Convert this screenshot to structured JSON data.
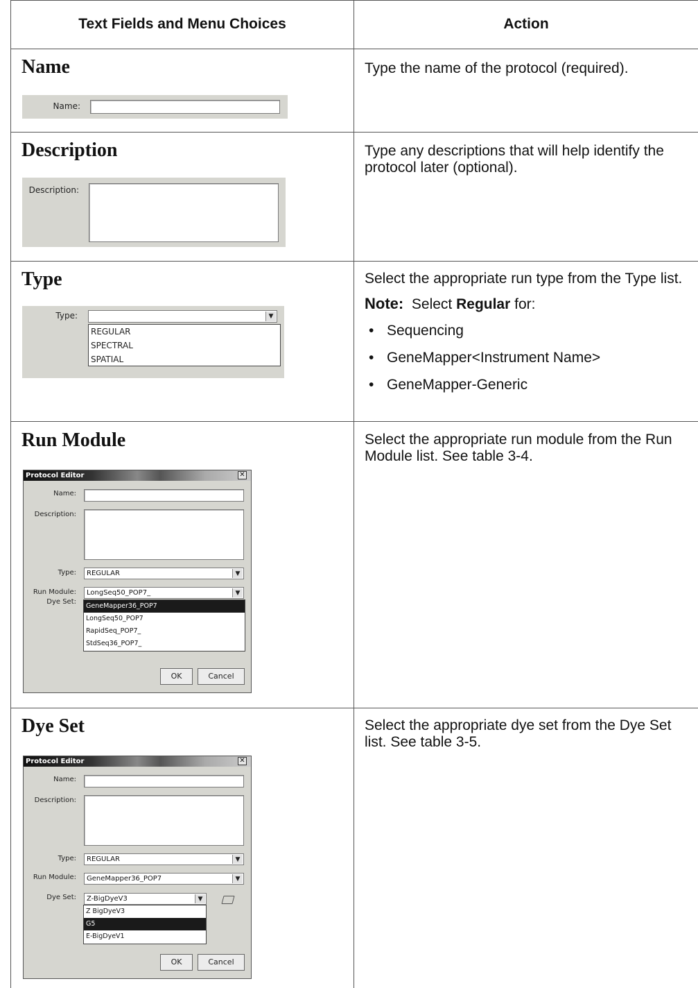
{
  "table": {
    "col1_header": "Text Fields and Menu Choices",
    "col2_header": "Action"
  },
  "rows": {
    "name": {
      "title": "Name",
      "action": "Type the name of the protocol (required).",
      "ui": {
        "name_label": "Name:",
        "name_value": ""
      }
    },
    "description": {
      "title": "Description",
      "action": "Type any descriptions that will help identify the protocol later (optional).",
      "ui": {
        "description_label": "Description:",
        "description_value": ""
      }
    },
    "type": {
      "title": "Type",
      "action": "Select the appropriate run type from the Type list.",
      "note_label": "Note:",
      "note_pre": "Select ",
      "note_bold": "Regular",
      "note_post": " for:",
      "bullets": [
        "Sequencing",
        "GeneMapper<Instrument Name>",
        "GeneMapper-Generic"
      ],
      "ui": {
        "type_label": "Type:",
        "type_value": "",
        "options": [
          "REGULAR",
          "SPECTRAL",
          "SPATIAL"
        ]
      }
    },
    "run_module": {
      "title": "Run Module",
      "action": "Select the appropriate run module from the Run Module list. See table 3-4.",
      "dialog": {
        "title": "Protocol Editor",
        "name_label": "Name:",
        "description_label": "Description:",
        "type_label": "Type:",
        "type_value": "REGULAR",
        "run_module_label": "Run Module:",
        "run_module_value": "LongSeq50_POP7_",
        "dye_set_label": "Dye Set:",
        "options": [
          "GeneMapper36_POP7",
          "LongSeq50_POP7",
          "RapidSeq_POP7_",
          "StdSeq36_POP7_"
        ],
        "highlighted_index": 0,
        "ok_label": "OK",
        "cancel_label": "Cancel"
      }
    },
    "dye_set": {
      "title": "Dye Set",
      "action": "Select the appropriate dye set from the Dye Set list. See table 3-5.",
      "dialog": {
        "title": "Protocol Editor",
        "name_label": "Name:",
        "description_label": "Description:",
        "type_label": "Type:",
        "type_value": "REGULAR",
        "run_module_label": "Run Module:",
        "run_module_value": "GeneMapper36_POP7",
        "dye_set_label": "Dye Set:",
        "dye_set_value": "Z-BigDyeV3",
        "options": [
          "Z BigDyeV3",
          "G5",
          "E-BigDyeV1"
        ],
        "highlighted_index": 1,
        "ok_label": "OK",
        "cancel_label": "Cancel"
      }
    }
  }
}
